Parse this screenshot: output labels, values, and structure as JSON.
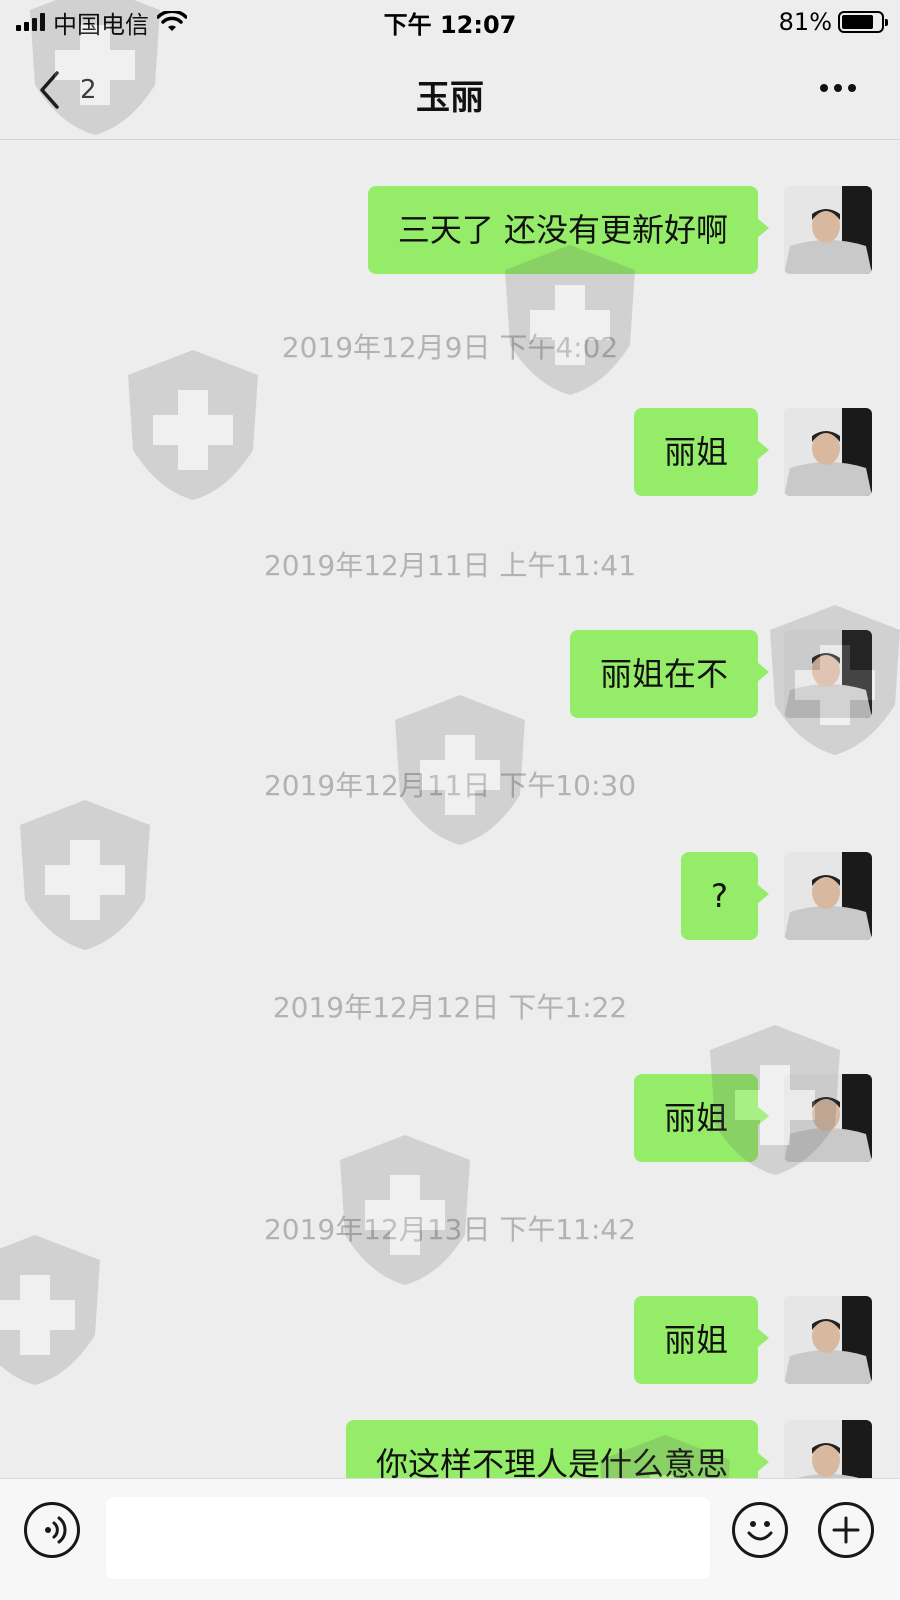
{
  "status_bar": {
    "carrier": "中国电信",
    "time": "下午 12:07",
    "battery": "81%",
    "battery_level": 0.81
  },
  "nav": {
    "back_count": "2",
    "title": "玉丽"
  },
  "partial_top_text": "...",
  "messages": [
    {
      "type": "sent",
      "text": "三天了 还没有更新好啊"
    },
    {
      "type": "time",
      "text": "2019年12月9日 下午4:02"
    },
    {
      "type": "sent",
      "text": "丽姐"
    },
    {
      "type": "time",
      "text": "2019年12月11日 上午11:41"
    },
    {
      "type": "sent",
      "text": "丽姐在不"
    },
    {
      "type": "time",
      "text": "2019年12月11日 下午10:30"
    },
    {
      "type": "sent",
      "text": "?"
    },
    {
      "type": "time",
      "text": "2019年12月12日 下午1:22"
    },
    {
      "type": "sent",
      "text": "丽姐"
    },
    {
      "type": "time",
      "text": "2019年12月13日 下午11:42"
    },
    {
      "type": "sent",
      "text": "丽姐"
    },
    {
      "type": "sent",
      "text": "你这样不理人是什么意思"
    }
  ],
  "input": {
    "value": "",
    "placeholder": ""
  },
  "colors": {
    "background": "#ededed",
    "sent_bubble": "#95ec69",
    "timestamp": "#b2b2b2"
  }
}
